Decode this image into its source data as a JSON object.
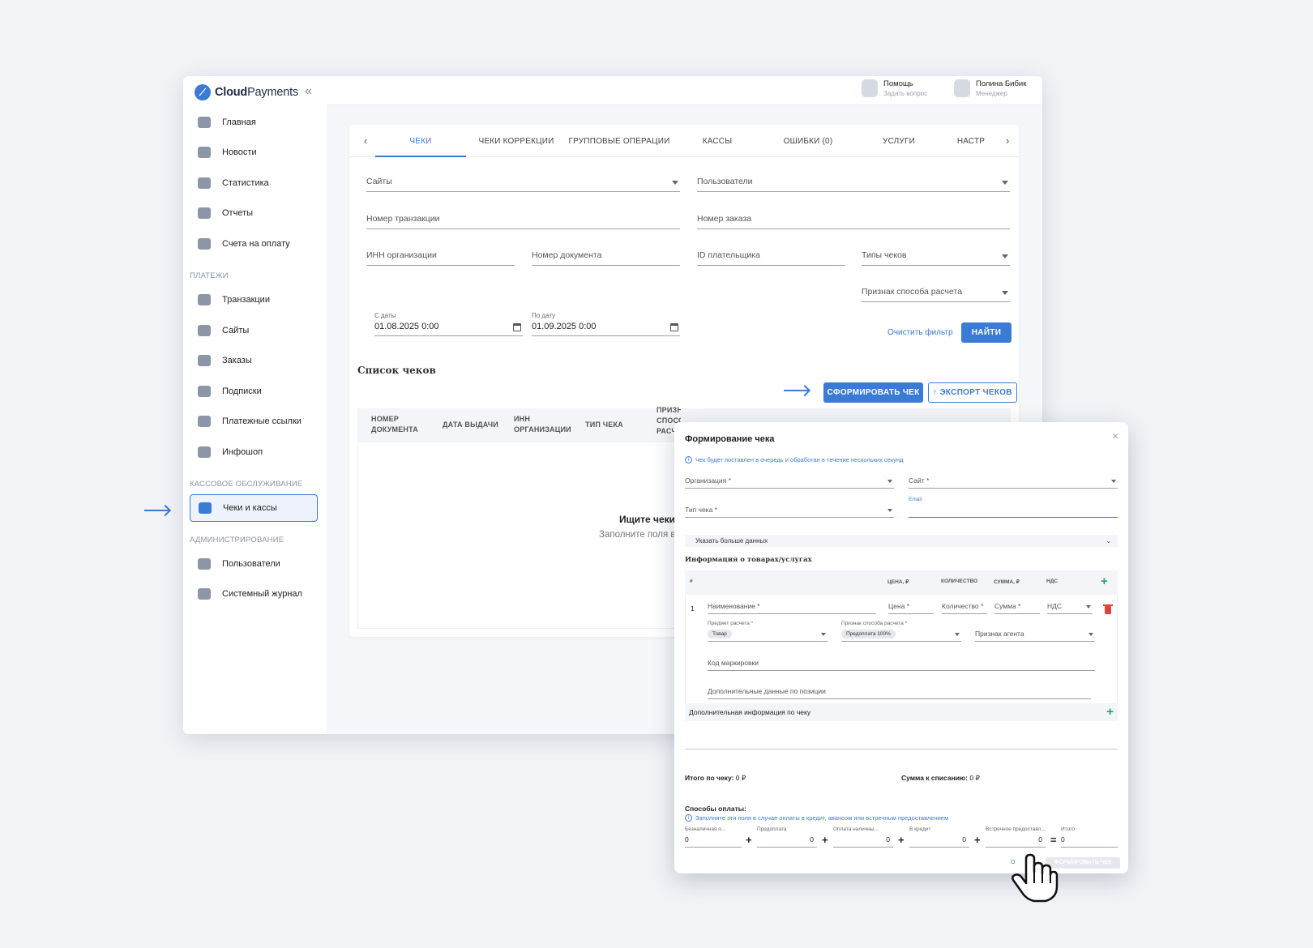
{
  "app": {
    "logo_bold": "Cloud",
    "logo_light": "Payments",
    "collapse_glyph": "«"
  },
  "sidebar": {
    "items": [
      {
        "label": "Главная",
        "icon": "home-icon"
      },
      {
        "label": "Новости",
        "icon": "news-icon"
      },
      {
        "label": "Статистика",
        "icon": "chart-icon"
      },
      {
        "label": "Отчеты",
        "icon": "reports-icon"
      },
      {
        "label": "Счета на оплату",
        "icon": "invoice-icon"
      }
    ],
    "section_payments": "ПЛАТЕЖИ",
    "payments_items": [
      {
        "label": "Транзакции",
        "icon": "transactions-icon"
      },
      {
        "label": "Сайты",
        "icon": "globe-icon"
      },
      {
        "label": "Заказы",
        "icon": "basket-icon"
      },
      {
        "label": "Подписки",
        "icon": "subscriptions-icon"
      },
      {
        "label": "Платежные ссылки",
        "icon": "link-icon"
      },
      {
        "label": "Инфошоп",
        "icon": "box-icon"
      }
    ],
    "section_cash": "КАССОВОЕ ОБСЛУЖИВАНИЕ",
    "cash_items": [
      {
        "label": "Чеки и кассы",
        "icon": "receipt-icon",
        "active": true
      }
    ],
    "section_admin": "АДМИНИСТРИРОВАНИЕ",
    "admin_items": [
      {
        "label": "Пользователи",
        "icon": "users-icon"
      },
      {
        "label": "Системный журнал",
        "icon": "journal-icon"
      }
    ]
  },
  "topbar": {
    "help_title": "Помощь",
    "help_sub": "Задать вопрос",
    "user_name": "Полина Бибик",
    "user_role": "Менеджер"
  },
  "tabs": [
    "ЧЕКИ",
    "ЧЕКИ КОРРЕКЦИИ",
    "ГРУППОВЫЕ ОПЕРАЦИИ",
    "КАССЫ",
    "ОШИБКИ (0)",
    "УСЛУГИ",
    "НАСТР"
  ],
  "filters": {
    "sites": "Сайты",
    "users": "Пользователи",
    "transaction_no": "Номер транзакции",
    "order_no": "Номер заказа",
    "inn": "ИНН организации",
    "doc_no": "Номер документа",
    "payer_id": "ID плательщика",
    "receipt_types": "Типы чеков",
    "calc_method": "Признак способа расчета",
    "date_from_label": "С даты",
    "date_from": "01.08.2025 0:00",
    "date_to_label": "По дату",
    "date_to": "01.09.2025 0:00",
    "clear": "Очистить фильтр",
    "find": "НАЙТИ"
  },
  "list": {
    "title": "Список чеков",
    "create_btn": "СФОРМИРОВАТЬ ЧЕК",
    "export_btn": "↑ ЭКСПОРТ ЧЕКОВ",
    "columns": [
      "НОМЕР\nДОКУМЕНТА",
      "ДАТА ВЫДАЧИ",
      "ИНН\nОРГАНИЗАЦИИ",
      "ТИП ЧЕКА",
      "ПРИЗНАК\nСПОСО\nРАСЧ"
    ],
    "empty_title": "Ищите чеки с",
    "empty_sub": "Заполните поля в"
  },
  "modal": {
    "title": "Формирование чека",
    "close": "×",
    "info": "Чек будет поставлен в очередь и обработан в течение нескольких секунд",
    "organization": "Организация *",
    "site": "Сайт *",
    "receipt_type": "Тип чека *",
    "email_label": "Email",
    "more_data": "Указать больше данных",
    "goods_title": "Информация о товарах/услугах",
    "goods_cols": [
      "#",
      "ЦЕНА, ₽",
      "КОЛИЧЕСТВО",
      "СУММА, ₽",
      "НДС"
    ],
    "row_no": "1",
    "name": "Наименование *",
    "price": "Цена *",
    "qty": "Количество *",
    "sum": "Сумма *",
    "vat": "НДС",
    "subject_label": "Предмет расчета *",
    "subject_value": "Товар",
    "method_label": "Признак способа расчета *",
    "method_value": "Предоплата 100%",
    "agent": "Признак агента",
    "marking": "Код маркировки",
    "extra_pos": "Дополнительные данные по позиции",
    "extra_info": "Дополнительная информация по чеку",
    "total_label": "Итого по чеку:",
    "total_value": "0 ₽",
    "writeoff_label": "Сумма к списанию:",
    "writeoff_value": "0 ₽",
    "payment_title": "Способы оплаты:",
    "payment_info": "Заполните эти поля в случае оплаты в кредит, авансом или встречным предоставлением",
    "pay_fields": [
      {
        "label": "Безналичная о...",
        "value": "0"
      },
      {
        "label": "Предоплата",
        "value": "0"
      },
      {
        "label": "Оплата наличны...",
        "value": "0"
      },
      {
        "label": "В кредит",
        "value": "0"
      },
      {
        "label": "Встречное предоставл...",
        "value": "0"
      },
      {
        "label": "Итого",
        "value": "0"
      }
    ],
    "cancel": "О",
    "submit": "ФОРМИРОВАТЬ ЧЕК"
  },
  "colors": {
    "accent": "#3a7bd5",
    "add": "#27a36a",
    "delete": "#e0433a"
  }
}
